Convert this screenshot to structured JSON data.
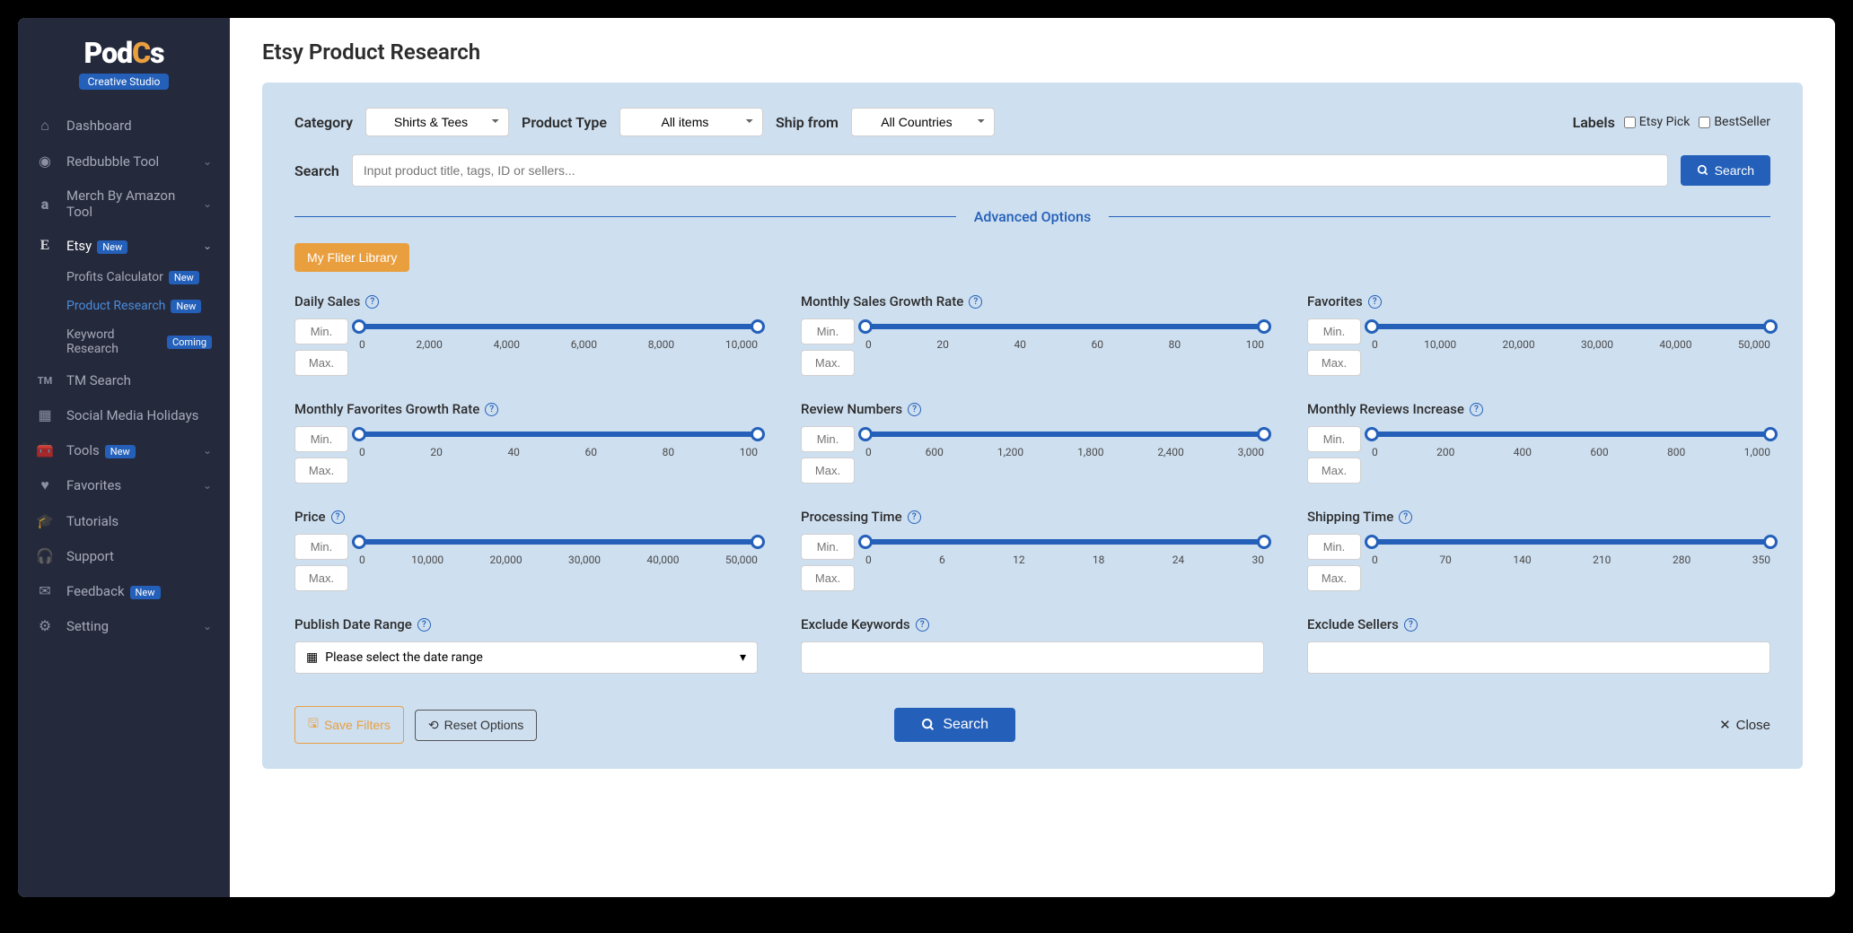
{
  "logo": {
    "brand": "PodCs",
    "sub": "Creative Studio"
  },
  "sidebar": {
    "items": [
      {
        "label": "Dashboard",
        "icon": "home",
        "badge": ""
      },
      {
        "label": "Redbubble Tool",
        "icon": "circle",
        "expandable": true
      },
      {
        "label": "Merch By Amazon Tool",
        "icon": "amazon",
        "expandable": true
      },
      {
        "label": "Etsy",
        "icon": "etsy",
        "badge": "New",
        "expandable": true,
        "expanded": true
      },
      {
        "label": "TM Search",
        "icon": "tm"
      },
      {
        "label": "Social Media Holidays",
        "icon": "calendar"
      },
      {
        "label": "Tools",
        "icon": "toolbox",
        "badge": "New",
        "expandable": true
      },
      {
        "label": "Favorites",
        "icon": "heart",
        "expandable": true
      },
      {
        "label": "Tutorials",
        "icon": "grad"
      },
      {
        "label": "Support",
        "icon": "headset"
      },
      {
        "label": "Feedback",
        "icon": "mail",
        "badge": "New"
      },
      {
        "label": "Setting",
        "icon": "gear",
        "expandable": true
      }
    ],
    "etsy_sub": [
      {
        "label": "Profits Calculator",
        "badge": "New"
      },
      {
        "label": "Product Research",
        "badge": "New",
        "active": true
      },
      {
        "label": "Keyword Research",
        "badge": "Coming"
      }
    ]
  },
  "page": {
    "title": "Etsy Product Research",
    "category_label": "Category",
    "category_value": "Shirts & Tees",
    "product_type_label": "Product Type",
    "product_type_value": "All items",
    "ship_from_label": "Ship from",
    "ship_from_value": "All Countries",
    "labels_label": "Labels",
    "etsy_pick": "Etsy Pick",
    "bestseller": "BestSeller",
    "search_label": "Search",
    "search_placeholder": "Input product title, tags, ID or sellers...",
    "search_btn": "Search",
    "advanced": "Advanced Options",
    "filter_lib": "My Fliter Library",
    "min_ph": "Min.",
    "max_ph": "Max.",
    "date_label": "Publish Date Range",
    "date_ph": "Please select the date range",
    "exclude_kw": "Exclude Keywords",
    "exclude_sellers": "Exclude Sellers",
    "save_filters": "Save Filters",
    "reset": "Reset Options",
    "close": "Close"
  },
  "filters": [
    {
      "title": "Daily Sales",
      "ticks": [
        "0",
        "2,000",
        "4,000",
        "6,000",
        "8,000",
        "10,000"
      ]
    },
    {
      "title": "Monthly Sales Growth Rate",
      "ticks": [
        "0",
        "20",
        "40",
        "60",
        "80",
        "100"
      ]
    },
    {
      "title": "Favorites",
      "ticks": [
        "0",
        "10,000",
        "20,000",
        "30,000",
        "40,000",
        "50,000"
      ]
    },
    {
      "title": "Monthly Favorites Growth Rate",
      "ticks": [
        "0",
        "20",
        "40",
        "60",
        "80",
        "100"
      ]
    },
    {
      "title": "Review Numbers",
      "ticks": [
        "0",
        "600",
        "1,200",
        "1,800",
        "2,400",
        "3,000"
      ]
    },
    {
      "title": "Monthly Reviews Increase",
      "ticks": [
        "0",
        "200",
        "400",
        "600",
        "800",
        "1,000"
      ]
    },
    {
      "title": "Price",
      "ticks": [
        "0",
        "10,000",
        "20,000",
        "30,000",
        "40,000",
        "50,000"
      ]
    },
    {
      "title": "Processing Time",
      "ticks": [
        "0",
        "6",
        "12",
        "18",
        "24",
        "30"
      ]
    },
    {
      "title": "Shipping Time",
      "ticks": [
        "0",
        "70",
        "140",
        "210",
        "280",
        "350"
      ]
    }
  ]
}
